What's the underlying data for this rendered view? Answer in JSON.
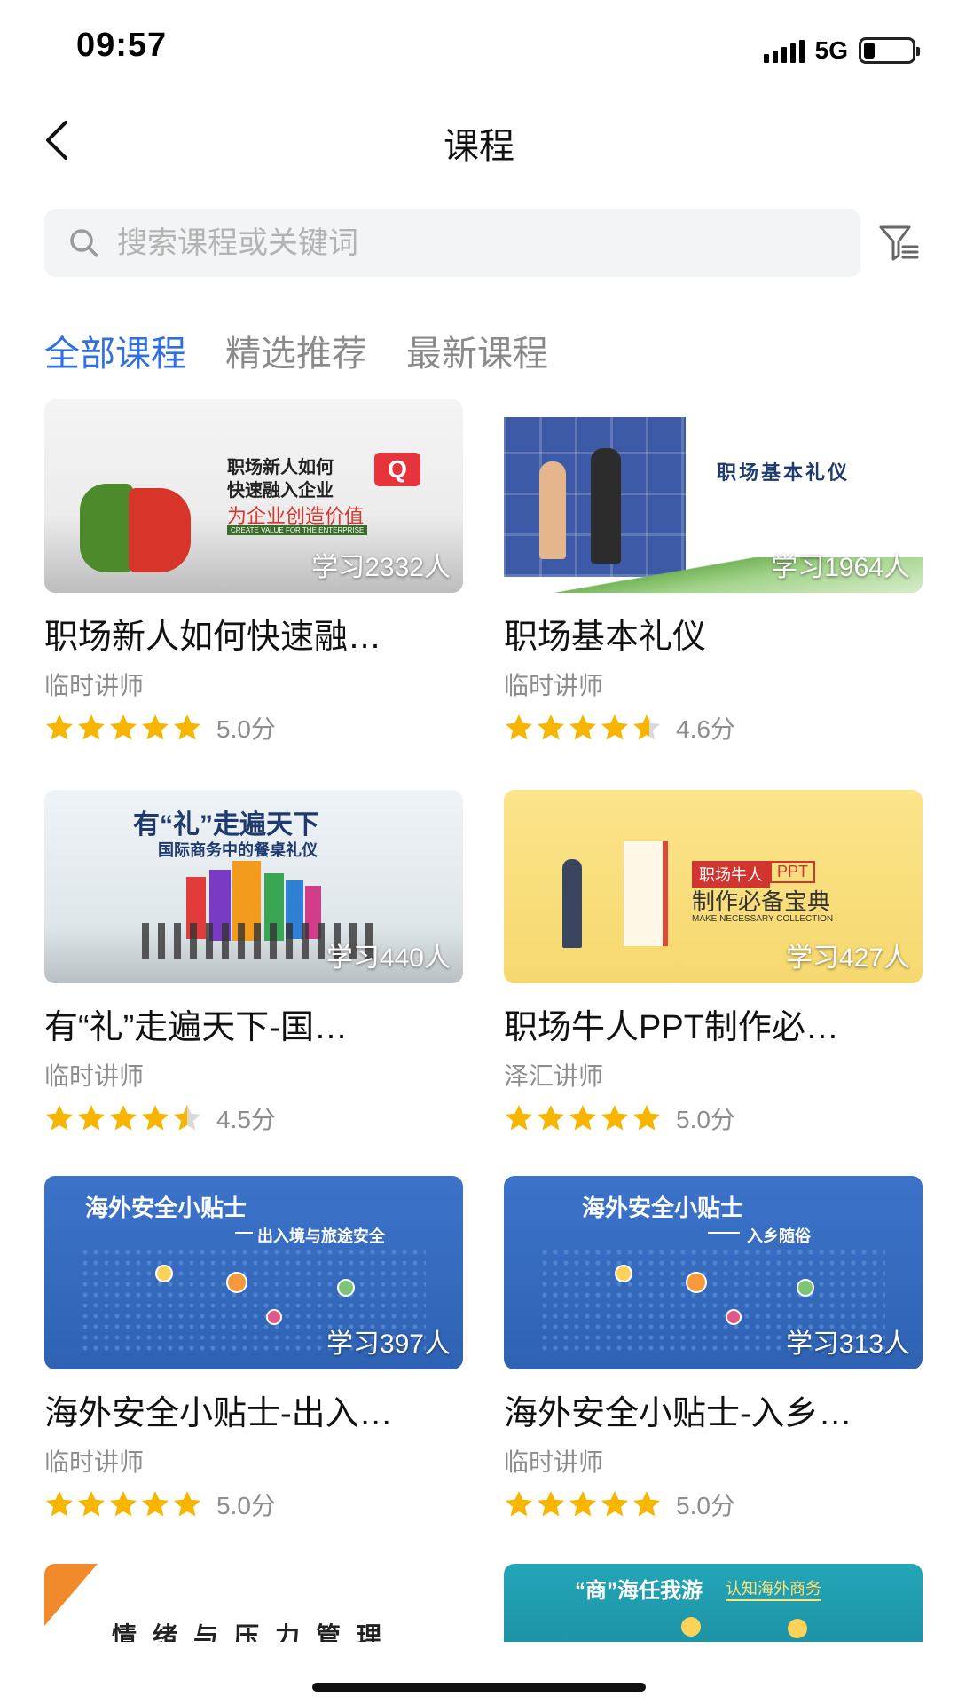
{
  "status_bar": {
    "time": "09:57",
    "network": "5G"
  },
  "nav": {
    "title": "课程",
    "back_icon": "chevron-left-icon"
  },
  "search": {
    "placeholder": "搜索课程或关键词",
    "icon": "search-icon",
    "filter_icon": "filter-icon"
  },
  "tabs": [
    {
      "label": "全部课程",
      "active": true
    },
    {
      "label": "精选推荐",
      "active": false
    },
    {
      "label": "最新课程",
      "active": false
    }
  ],
  "courses": [
    {
      "title": "职场新人如何快速融…",
      "learners": "学习2332人",
      "teacher": "临时讲师",
      "rating": 5.0,
      "score": "5.0分",
      "thumb_text": [
        "职场新人如何",
        "快速融入企业",
        "为企业创造价值",
        "CREATE VALUE FOR THE ENTERPRISE",
        "Q"
      ]
    },
    {
      "title": "职场基本礼仪",
      "learners": "学习1964人",
      "teacher": "临时讲师",
      "rating": 4.6,
      "score": "4.6分",
      "thumb_text": [
        "职场基本礼仪"
      ]
    },
    {
      "title": "有“礼”走遍天下-国…",
      "learners": "学习440人",
      "teacher": "临时讲师",
      "rating": 4.5,
      "score": "4.5分",
      "thumb_text": [
        "有“礼”走遍天下",
        "国际商务中的餐桌礼仪"
      ]
    },
    {
      "title": "职场牛人PPT制作必…",
      "learners": "学习427人",
      "teacher": "泽汇讲师",
      "rating": 5.0,
      "score": "5.0分",
      "thumb_text": [
        "职场牛人",
        "PPT",
        "制作必备宝典",
        "MAKE NECESSARY COLLECTION"
      ]
    },
    {
      "title": "海外安全小贴士-出入…",
      "learners": "学习397人",
      "teacher": "临时讲师",
      "rating": 5.0,
      "score": "5.0分",
      "thumb_text": [
        "海外安全小贴士",
        "出入境与旅途安全"
      ]
    },
    {
      "title": "海外安全小贴士-入乡…",
      "learners": "学习313人",
      "teacher": "临时讲师",
      "rating": 5.0,
      "score": "5.0分",
      "thumb_text": [
        "海外安全小贴士",
        "入乡随俗"
      ]
    }
  ],
  "partial_cards": [
    {
      "thumb_text": [
        "情绪与压力管理"
      ]
    },
    {
      "thumb_text": [
        "“商”海任我游",
        "认知海外商务"
      ]
    }
  ],
  "colors": {
    "accent": "#2f6fe4",
    "star": "#f7b500",
    "star_empty": "#d9d9d9",
    "muted": "#8d8d8d"
  }
}
